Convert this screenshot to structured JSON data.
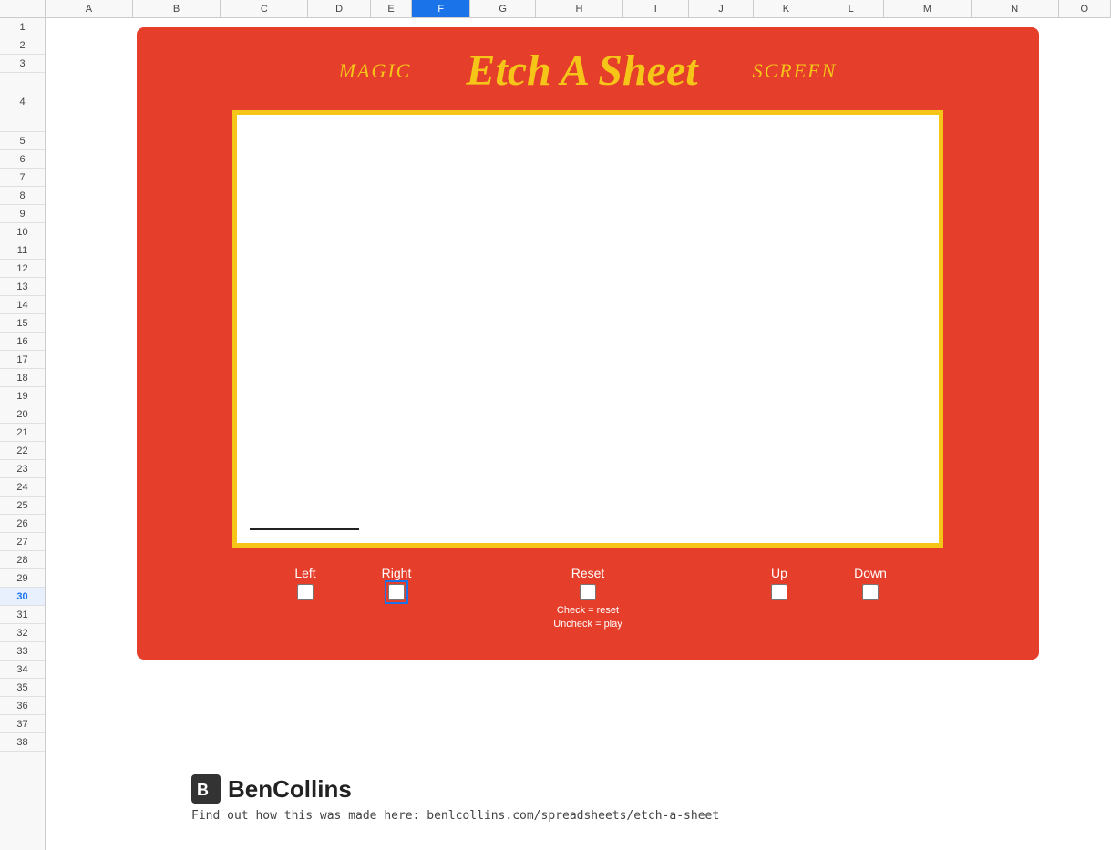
{
  "spreadsheet": {
    "columns": [
      "A",
      "B",
      "C",
      "D",
      "E",
      "F",
      "G",
      "H",
      "I",
      "J",
      "K",
      "L",
      "M",
      "N",
      "O"
    ],
    "active_col": "F",
    "rows": [
      1,
      2,
      3,
      4,
      5,
      6,
      7,
      8,
      9,
      10,
      11,
      12,
      13,
      14,
      15,
      16,
      17,
      18,
      19,
      20,
      21,
      22,
      23,
      24,
      25,
      26,
      27,
      28,
      29,
      30,
      31,
      32,
      33,
      34,
      35,
      36,
      37,
      38
    ],
    "active_row": 30
  },
  "etch": {
    "magic_label": "MAGIC",
    "title": "Etch A Sheet",
    "screen_label": "SCREEN",
    "controls": {
      "left_label": "Left",
      "right_label": "Right",
      "reset_label": "Reset",
      "up_label": "Up",
      "down_label": "Down",
      "reset_hint_line1": "Check = reset",
      "reset_hint_line2": "Uncheck = play"
    }
  },
  "footer": {
    "author": "BenCollins",
    "link_text": "Find out how this was made here: benlcollins.com/spreadsheets/etch-a-sheet"
  },
  "colors": {
    "red_bg": "#e53e2b",
    "yellow_accent": "#f5c518",
    "white": "#ffffff"
  }
}
